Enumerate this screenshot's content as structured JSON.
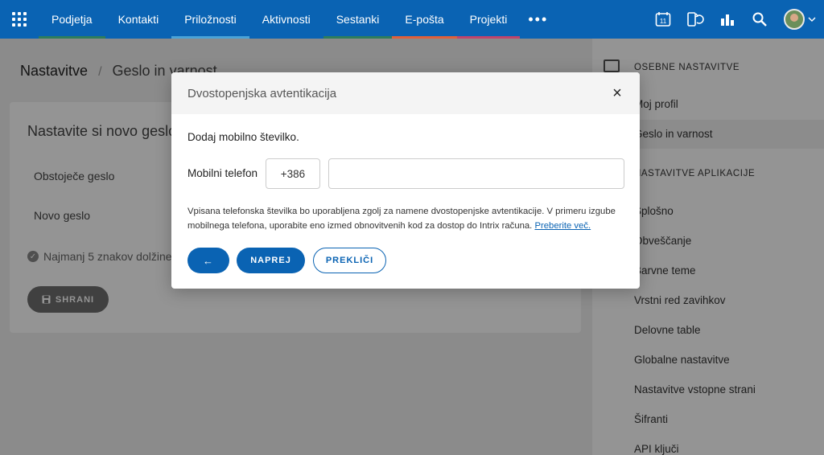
{
  "nav": {
    "items": [
      {
        "label": "Podjetja",
        "bar": "#2e7d5b"
      },
      {
        "label": "Kontakti",
        "bar": "#0a63b3"
      },
      {
        "label": "Priložnosti",
        "bar": "#4aa3d8"
      },
      {
        "label": "Aktivnosti",
        "bar": "#0a63b3"
      },
      {
        "label": "Sestanki",
        "bar": "#2e7d5b"
      },
      {
        "label": "E-pošta",
        "bar": "#e0603a"
      },
      {
        "label": "Projekti",
        "bar": "#c0446b"
      }
    ],
    "more": "•••",
    "calendar_day": "11"
  },
  "page": {
    "breadcrumb_root": "Nastavitve",
    "breadcrumb_sep": "/",
    "breadcrumb_current": "Geslo in varnost",
    "card_title": "Nastavite si novo geslo",
    "existing_password_label": "Obstoječe geslo",
    "new_password_label": "Novo geslo",
    "requirement": "Najmanj 5 znakov dolžine",
    "save_label": "SHRANI"
  },
  "sidebar": {
    "section_personal": "OSEBNE NASTAVITVE",
    "my_profile": "Moj profil",
    "password_security": "Geslo in varnost",
    "section_app": "NASTAVITVE APLIKACIJE",
    "items": [
      "Splošno",
      "Obveščanje",
      "Barvne teme",
      "Vrstni red zavihkov",
      "Delovne table",
      "Globalne nastavitve",
      "Nastavitve vstopne strani",
      "Šifranti",
      "API ključi"
    ]
  },
  "modal": {
    "title": "Dvostopenjska avtentikacija",
    "close": "×",
    "subtitle": "Dodaj mobilno številko.",
    "phone_label": "Mobilni telefon",
    "prefix": "+386",
    "phone_value": "",
    "info": "Vpisana telefonska številka bo uporabljena zgolj za namene dvostopenjske avtentikacije. V primeru izgube mobilnega telefona, uporabite eno izmed obnovitvenih kod za dostop do Intrix računa.",
    "info_link": "Preberite več.",
    "back": "←",
    "next": "NAPREJ",
    "cancel": "PREKLIČI"
  },
  "colors": {
    "accent": "#0a63b3"
  }
}
